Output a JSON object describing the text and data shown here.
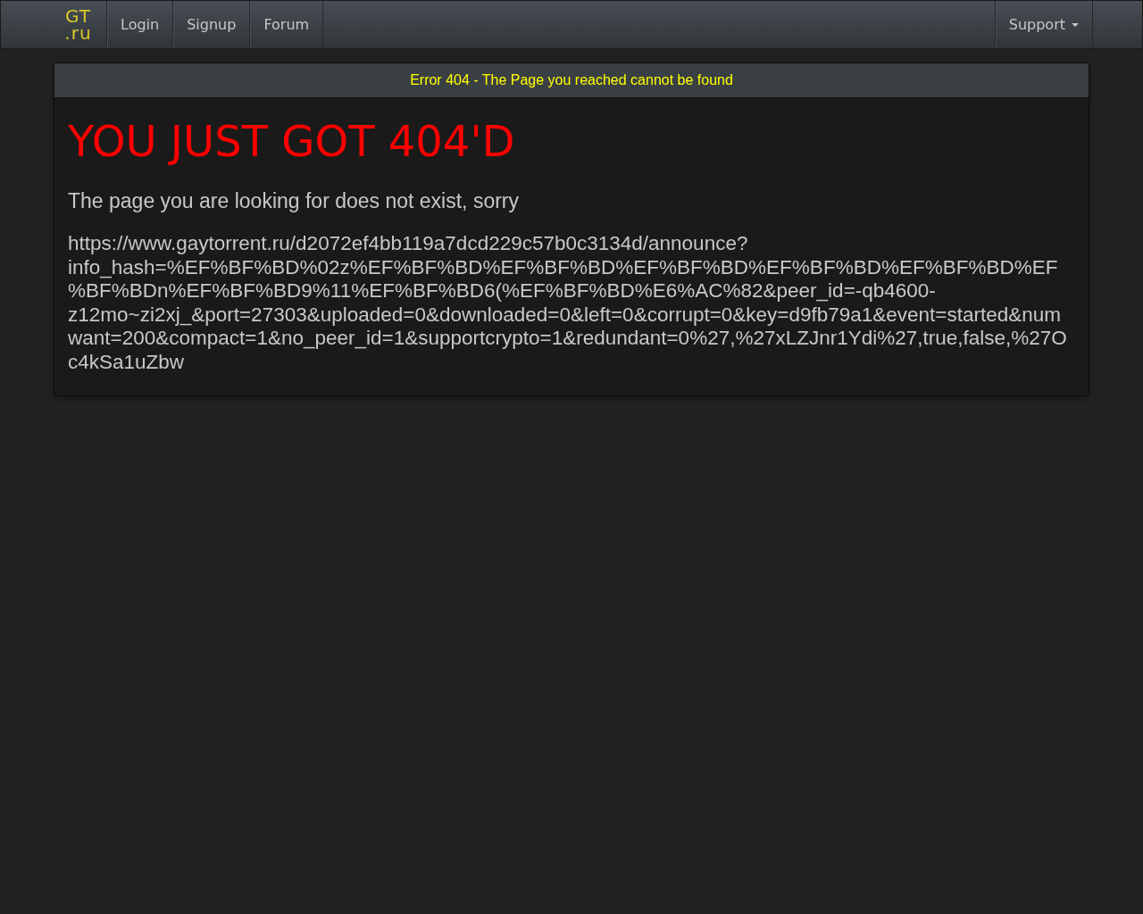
{
  "navbar": {
    "logo": {
      "top": "GT",
      "bottom": ".ru"
    },
    "links": [
      {
        "label": "Login"
      },
      {
        "label": "Signup"
      },
      {
        "label": "Forum"
      }
    ],
    "right_links": [
      {
        "label": "Support",
        "dropdown": true
      }
    ]
  },
  "panel": {
    "heading": "Error 404 - The Page you reached cannot be found",
    "title": "YOU JUST GOT 404'D",
    "message": "The page you are looking for does not exist, sorry",
    "url": "https://www.gaytorrent.ru/d2072ef4bb119a7dcd229c57b0c3134d/announce?info_hash=%EF%BF%BD%02z%EF%BF%BD%EF%BF%BD%EF%BF%BD%EF%BF%BD%EF%BF%BD%EF%BF%BDn%EF%BF%BD9%11%EF%BF%BD6(%EF%BF%BD%E6%AC%82&peer_id=-qb4600-z12mo~zi2xj_&port=27303&uploaded=0&downloaded=0&left=0&corrupt=0&key=d9fb79a1&event=started&numwant=200&compact=1&no_peer_id=1&supportcrypto=1&redundant=0%27,%27xLZJnr1Ydi%27,true,false,%27Oc4kSa1uZbw"
  }
}
